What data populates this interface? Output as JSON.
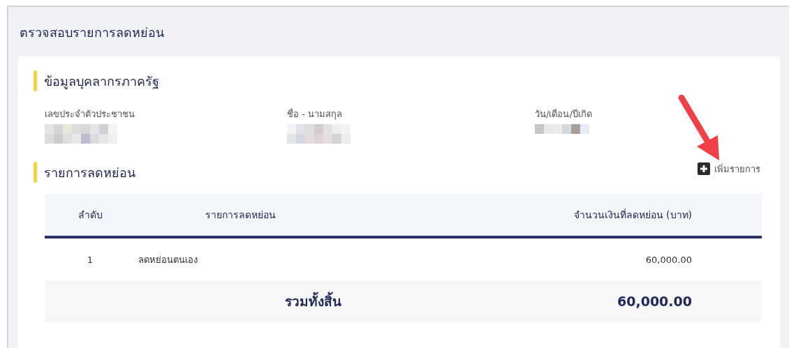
{
  "page": {
    "title": "ตรวจสอบรายการลดหย่อน"
  },
  "personal_section": {
    "title": "ข้อมูลบุคลากรภาครัฐ",
    "fields": [
      {
        "label": "เลขประจำตัวประชาชน",
        "value_hidden": true
      },
      {
        "label": "ชื่อ - นามสกุล",
        "value_hidden": true
      },
      {
        "label": "วัน/เดือน/ปีเกิด",
        "value_hidden": true
      }
    ]
  },
  "deduction_section": {
    "title": "รายการลดหย่อน",
    "add_button": {
      "label": "เพิ่มรายการ"
    },
    "table": {
      "columns": [
        "ลำดับ",
        "รายการลดหย่อน",
        "จำนวนเงินที่ลดหย่อน (บาท)"
      ],
      "rows": [
        {
          "index": "1",
          "item": "ลดหย่อนตนเอง",
          "amount": "60,000.00"
        }
      ],
      "total": {
        "label": "รวมทั้งสิ้น",
        "amount": "60,000.00"
      }
    }
  },
  "annotation": {
    "kind": "arrow"
  }
}
